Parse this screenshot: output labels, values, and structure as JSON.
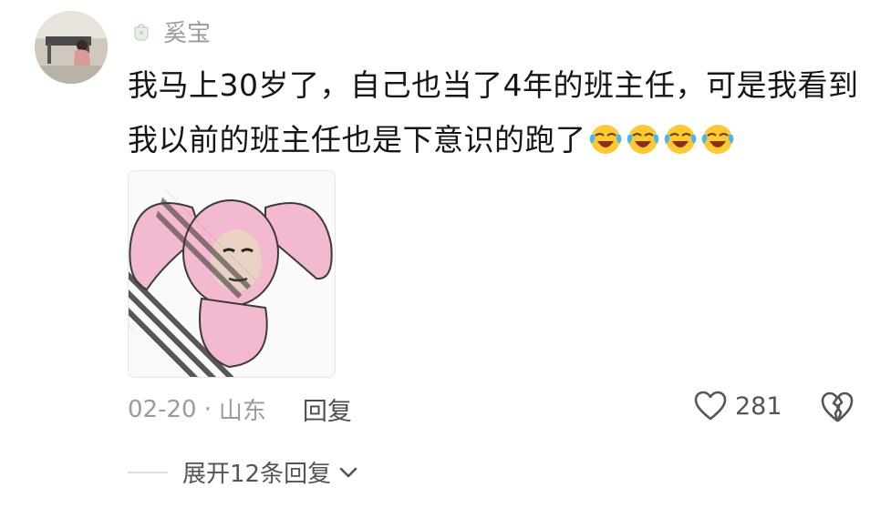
{
  "comment": {
    "username": "奚宝",
    "badge_icon": "teacup-icon",
    "avatar_icon": "user-avatar",
    "text_lines": [
      "我马上30岁了，自己也当了4年的班主任，可是我看到",
      "我以前的班主任也是下意识的跑了"
    ],
    "emojis": [
      "laughing-tears-emoji",
      "laughing-tears-emoji",
      "laughing-tears-emoji",
      "laughing-tears-emoji"
    ],
    "sticker": "pink-bunny-meme-sticker",
    "date": "02-20",
    "separator": "·",
    "location": "山东",
    "reply_label": "回复",
    "like_count": "281",
    "like_icon": "heart-outline-icon",
    "dislike_icon": "broken-heart-icon"
  },
  "replies": {
    "expand_label": "展开12条回复",
    "expand_icon": "chevron-down-icon"
  },
  "colors": {
    "meta_gray": "#9b9b9b",
    "text_dark": "#161616",
    "sticker_pink": "#f3b9d0"
  }
}
